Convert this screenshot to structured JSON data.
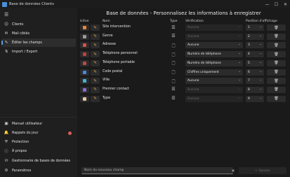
{
  "window": {
    "title": "Base de données Clients",
    "controls": [
      "—",
      "☐",
      "✕"
    ]
  },
  "sidebar": {
    "menu_icon": "☰",
    "top_items": [
      {
        "label": "Clients",
        "icon": "person-icon",
        "glyph": "☺"
      },
      {
        "label": "Mail ciblés",
        "icon": "mail-icon",
        "glyph": "✉"
      },
      {
        "label": "Éditer les champs",
        "icon": "pencil-icon",
        "glyph": "✎",
        "active": true
      },
      {
        "label": "Import / Export",
        "icon": "import-export-icon",
        "glyph": "⇅"
      }
    ],
    "bottom_items": [
      {
        "label": "Manuel utilisateur",
        "icon": "book-icon",
        "glyph": "▣"
      },
      {
        "label": "Rappels du jour",
        "icon": "bell-icon",
        "glyph": "🔔",
        "badge": true
      },
      {
        "label": "Protection",
        "icon": "shield-icon",
        "glyph": "⛨"
      },
      {
        "label": "À propos",
        "icon": "info-icon",
        "glyph": "ⓘ"
      },
      {
        "label": "Gestionnaire de bases de données",
        "icon": "database-icon",
        "glyph": "⛁"
      },
      {
        "label": "Paramètres",
        "icon": "gear-icon",
        "glyph": "⚙"
      }
    ]
  },
  "main": {
    "title": "Base de données - Personnalisez les informations à enregistrer",
    "headers": {
      "icon": "Icône",
      "name": "Nom",
      "type": "Type",
      "verification": "Vérification",
      "position": "Position d'affichage"
    },
    "rows": [
      {
        "name": "Site intervention",
        "color": "#e8873a",
        "type_glyph": "☰",
        "verification": "Aucune",
        "verification_enabled": false,
        "position": "1"
      },
      {
        "name": "Genre",
        "color": "#9a9a9a",
        "type_glyph": "☰",
        "verification": "Aucune",
        "verification_enabled": false,
        "position": "2"
      },
      {
        "name": "Adresse",
        "color": "#d94f4f",
        "type_glyph": "🗋",
        "verification": "Aucune",
        "verification_enabled": true,
        "position": "3"
      },
      {
        "name": "Téléphone personnel",
        "color": "#c04040",
        "type_glyph": "🗋",
        "verification": "Numéro de téléphone",
        "verification_enabled": true,
        "position": "4"
      },
      {
        "name": "Téléphone portable",
        "color": "#b84a4a",
        "type_glyph": "🗋",
        "verification": "Numéro de téléphone",
        "verification_enabled": true,
        "position": "5"
      },
      {
        "name": "Code postal",
        "color": "#4a86d8",
        "type_glyph": "🗋",
        "verification": "Chiffres uniquement",
        "verification_enabled": true,
        "position": "6"
      },
      {
        "name": "Ville",
        "color": "#4ab0d8",
        "type_glyph": "🗋",
        "verification": "Aucune",
        "verification_enabled": true,
        "position": "7"
      },
      {
        "name": "Premier contact",
        "color": "#8a6ad8",
        "type_glyph": "☰",
        "verification": "Aucune",
        "verification_enabled": false,
        "position": "8"
      },
      {
        "name": "Type",
        "color": "#e0c9a8",
        "type_glyph": "☰",
        "verification": "Aucune",
        "verification_enabled": false,
        "position": "9"
      }
    ],
    "edit_glyph": "✎",
    "delete_glyph": "🗑",
    "chevron": "⌄",
    "new_field_placeholder": "Nom du nouveau champ",
    "clear_glyph": "✕",
    "add_label": "+ Ajouter"
  }
}
